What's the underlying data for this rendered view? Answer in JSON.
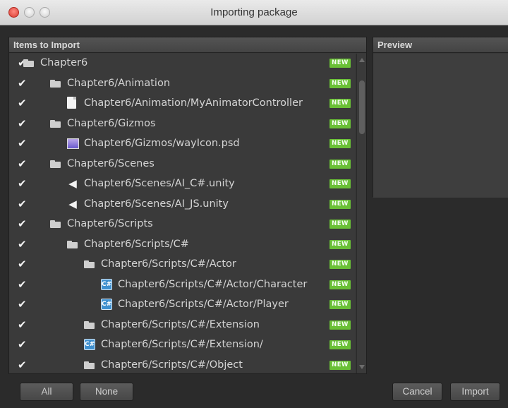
{
  "window": {
    "title": "Importing package"
  },
  "items_panel": {
    "header": "Items to Import"
  },
  "preview_panel": {
    "header": "Preview"
  },
  "badge_text": "NEW",
  "colors": {
    "badge_green": "#6ac036",
    "panel_bg": "#383838",
    "row_text": "#d4d4d4"
  },
  "items": [
    {
      "label": "Chapter6",
      "icon": "folder-icon",
      "checked": true,
      "badge": "NEW"
    },
    {
      "label": "Chapter6/Animation",
      "icon": "folder-icon",
      "checked": true,
      "badge": "NEW"
    },
    {
      "label": "Chapter6/Animation/MyAnimatorController",
      "icon": "file-icon",
      "checked": true,
      "badge": "NEW"
    },
    {
      "label": "Chapter6/Gizmos",
      "icon": "folder-icon",
      "checked": true,
      "badge": "NEW"
    },
    {
      "label": "Chapter6/Gizmos/wayIcon.psd",
      "icon": "image-icon",
      "checked": true,
      "badge": "NEW"
    },
    {
      "label": "Chapter6/Scenes",
      "icon": "folder-icon",
      "checked": true,
      "badge": "NEW"
    },
    {
      "label": "Chapter6/Scenes/AI_C#.unity",
      "icon": "unity-icon",
      "checked": true,
      "badge": "NEW"
    },
    {
      "label": "Chapter6/Scenes/AI_JS.unity",
      "icon": "unity-icon",
      "checked": true,
      "badge": "NEW"
    },
    {
      "label": "Chapter6/Scripts",
      "icon": "folder-icon",
      "checked": true,
      "badge": "NEW"
    },
    {
      "label": "Chapter6/Scripts/C#",
      "icon": "folder-icon",
      "checked": true,
      "badge": "NEW"
    },
    {
      "label": "Chapter6/Scripts/C#/Actor",
      "icon": "folder-icon",
      "checked": true,
      "badge": "NEW"
    },
    {
      "label": "Chapter6/Scripts/C#/Actor/Character",
      "icon": "cs-script-icon",
      "checked": true,
      "badge": "NEW"
    },
    {
      "label": "Chapter6/Scripts/C#/Actor/Player",
      "icon": "cs-script-icon",
      "checked": true,
      "badge": "NEW"
    },
    {
      "label": "Chapter6/Scripts/C#/Extension",
      "icon": "folder-icon",
      "checked": true,
      "badge": "NEW"
    },
    {
      "label": "Chapter6/Scripts/C#/Extension/",
      "icon": "cs-script-icon",
      "checked": true,
      "badge": "NEW"
    },
    {
      "label": "Chapter6/Scripts/C#/Object",
      "icon": "folder-icon",
      "checked": true,
      "badge": "NEW"
    }
  ],
  "buttons": {
    "all": "All",
    "none": "None",
    "cancel": "Cancel",
    "import": "Import"
  }
}
